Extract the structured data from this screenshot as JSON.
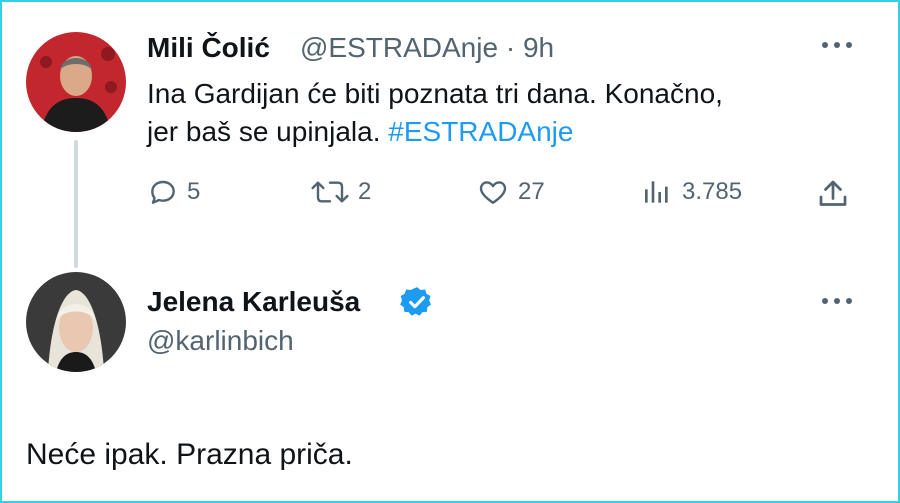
{
  "tweet1": {
    "name": "Mili Čolić",
    "handle": "@ESTRADAnje",
    "dot": "·",
    "time": "9h",
    "text_line1": "Ina Gardijan će biti poznata tri dana. Konačno,",
    "text_line2": "jer baš se upinjala.",
    "hashtag": "#ESTRADAnje",
    "replies": "5",
    "retweets": "2",
    "likes": "27",
    "views": "3.785"
  },
  "tweet2": {
    "name": "Jelena Karleuša",
    "handle": "@karlinbich",
    "text": "Neće ipak. Prazna priča."
  },
  "colors": {
    "accent": "#1d9bf0",
    "frame": "#35d0e6",
    "muted": "#536471"
  }
}
